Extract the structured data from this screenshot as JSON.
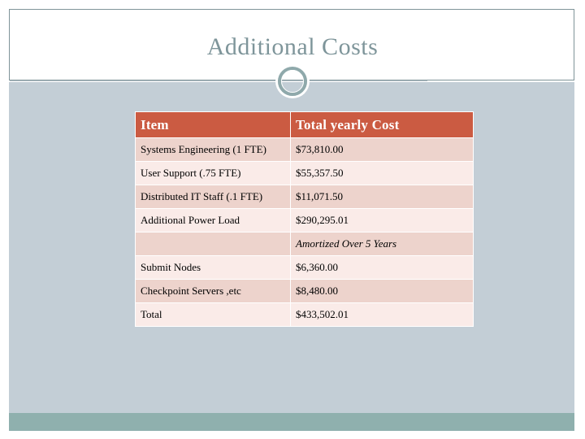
{
  "slide": {
    "title": "Additional Costs",
    "colors": {
      "title_text": "#7e959a",
      "body_background": "#c3ced6",
      "footer_bar": "#8fb0ae",
      "table_header_bg": "#cb5b42",
      "table_header_text": "#ffffff",
      "row_dark": "#edd3cc",
      "row_light": "#faebe8",
      "rule": "#b9c4cc",
      "ring": "#8fa9ab"
    }
  },
  "table": {
    "columns": [
      "Item",
      "Total yearly Cost"
    ],
    "rows": [
      {
        "type": "data",
        "item": "Systems Engineering (1 FTE)",
        "cost": "$73,810.00",
        "shade": "dark"
      },
      {
        "type": "data",
        "item": "User Support (.75 FTE)",
        "cost": "$55,357.50",
        "shade": "light"
      },
      {
        "type": "data",
        "item": "Distributed IT Staff (.1 FTE)",
        "cost": "$11,071.50",
        "shade": "dark"
      },
      {
        "type": "data",
        "item": "Additional Power Load",
        "cost": "$290,295.01",
        "shade": "light"
      },
      {
        "type": "note",
        "item": "",
        "cost": "Amortized Over 5 Years",
        "shade": "dark"
      },
      {
        "type": "data",
        "item": "Submit Nodes",
        "cost": "$6,360.00",
        "shade": "light"
      },
      {
        "type": "data",
        "item": "Checkpoint Servers ,etc",
        "cost": "$8,480.00",
        "shade": "dark"
      },
      {
        "type": "total",
        "item": "Total",
        "cost": "$433,502.01",
        "shade": "light"
      }
    ]
  }
}
